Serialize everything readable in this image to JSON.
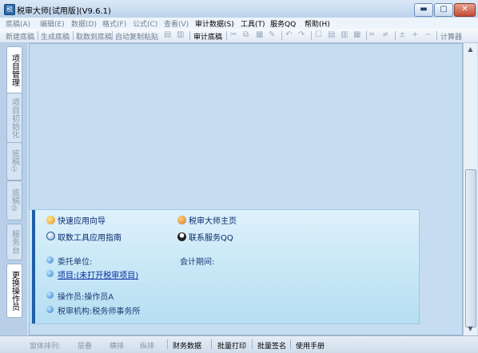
{
  "window": {
    "title": "税审大师[试用版](V9.6.1)",
    "app_icon": "税",
    "controls": {
      "minimize": "▬",
      "maximize": "▢",
      "close": "✕"
    }
  },
  "menu": [
    {
      "label": "底稿(A)",
      "enabled": false
    },
    {
      "label": "编辑(E)",
      "enabled": false
    },
    {
      "label": "数据(D)",
      "enabled": false
    },
    {
      "label": "格式(F)",
      "enabled": false
    },
    {
      "label": "公式(C)",
      "enabled": false
    },
    {
      "label": "查看(V)",
      "enabled": false
    },
    {
      "label": "审计数据(S)",
      "enabled": true
    },
    {
      "label": "工具(T)",
      "enabled": true
    },
    {
      "label": "服务QQ",
      "enabled": true
    },
    {
      "label": "帮助(H)",
      "enabled": true
    }
  ],
  "toolbar": {
    "buttons": [
      "新建底稿",
      "生成底稿",
      "取数到底稿",
      "自动复制粘贴"
    ],
    "active_button": "审计底稿",
    "calc_label": "计算器",
    "glyphs": [
      "▤",
      "▥",
      "✂",
      "⧉",
      "▦",
      "✎",
      "↶",
      "↷",
      "☐",
      "▤",
      "▥",
      "▦",
      "═",
      "≠",
      "±",
      "+",
      "−"
    ]
  },
  "sidebar_tabs": [
    {
      "label": "项目管理",
      "active": true
    },
    {
      "label": "项目初始化",
      "active": false
    },
    {
      "label": "底稿①",
      "active": false
    },
    {
      "label": "底稿②",
      "active": false
    },
    {
      "label": "服务台",
      "active": false
    },
    {
      "label": "更换操作员",
      "active": true
    }
  ],
  "panel": {
    "quick_guide": "快速应用向导",
    "home": "税审大师主页",
    "fetch_guide": "取数工具应用指南",
    "contact": "联系服务QQ",
    "client_label": "委托单位:",
    "period_label": "会计期间:",
    "project_label": "项目:",
    "project_value": "(未打开税审项目)",
    "operator_label": "操作员:",
    "operator_value": "操作员A",
    "agency_label": "税审机构:",
    "agency_value": "税务师事务所",
    "icons": [
      "wand-icon",
      "home-icon",
      "search-icon",
      "qq-icon"
    ]
  },
  "scrollbar": {
    "up": "▲",
    "down": "▼"
  },
  "statusbar": {
    "arrange_label": "窗体排列:",
    "cascade": "层叠",
    "tile_h": "横排",
    "tile_v": "纵排",
    "finance": "财务数据",
    "batch_print": "批量打印",
    "batch_sign": "批量签名",
    "manual": "使用手册"
  },
  "colors": {
    "accent": "#1f5fa8",
    "link": "#0a2a9e",
    "canvas": "#c6dcf0"
  }
}
